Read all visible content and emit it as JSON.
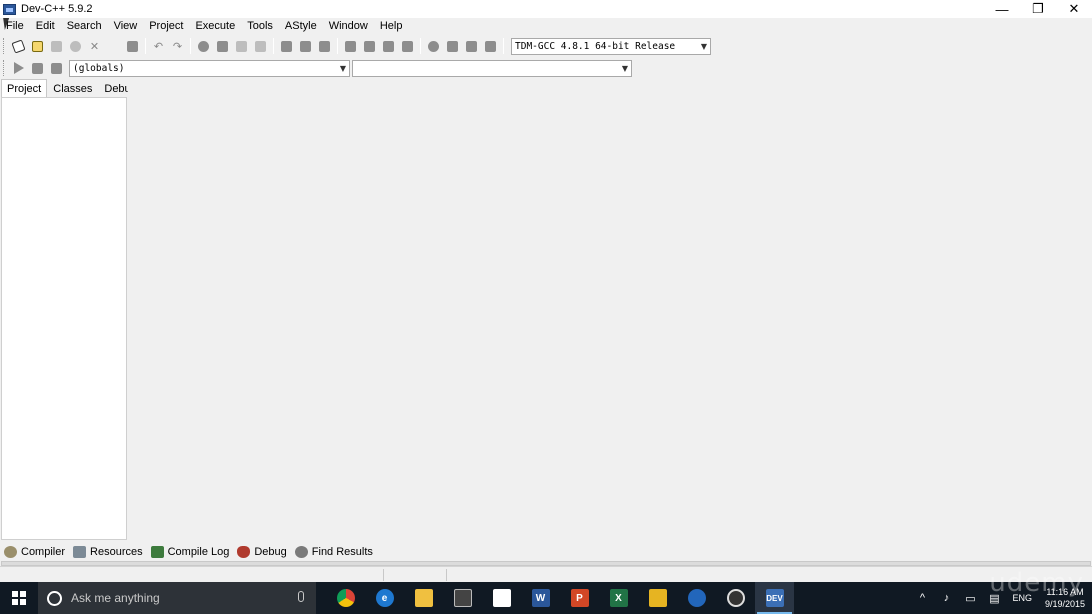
{
  "window": {
    "title": "Dev-C++ 5.9.2",
    "controls": [
      "—",
      "❐",
      "✕"
    ]
  },
  "menu": [
    "File",
    "Edit",
    "Search",
    "View",
    "Project",
    "Execute",
    "Tools",
    "AStyle",
    "Window",
    "Help"
  ],
  "toolbar": {
    "compiler_selected": "TDM-GCC 4.8.1 64-bit Release",
    "globals_selected": "(globals)",
    "members_selected": ""
  },
  "left_panel": {
    "tabs": [
      "Project",
      "Classes",
      "Debug"
    ],
    "active_tab": "Project"
  },
  "bottom_tabs": [
    "Compiler",
    "Resources",
    "Compile Log",
    "Debug",
    "Find Results"
  ],
  "taskbar": {
    "search_placeholder": "Ask me anything",
    "apps": [
      "chrome-icon",
      "edge-icon",
      "file-explorer-icon",
      "calculator-icon",
      "store-icon",
      "word-icon",
      "powerpoint-icon",
      "excel-icon",
      "app-green-icon",
      "app-blue-icon",
      "obs-icon",
      "devcpp-icon"
    ],
    "active_app": "devcpp-icon",
    "language": "ENG",
    "time": "11:16 AM",
    "date": "9/19/2015"
  },
  "watermark": "udemy"
}
